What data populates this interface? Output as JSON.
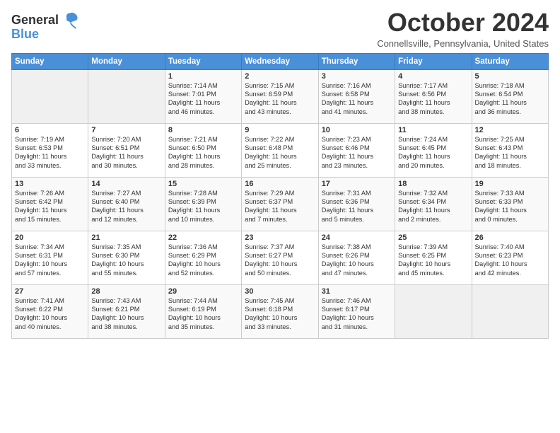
{
  "logo": {
    "line1": "General",
    "line2": "Blue"
  },
  "header": {
    "month": "October 2024",
    "location": "Connellsville, Pennsylvania, United States"
  },
  "weekdays": [
    "Sunday",
    "Monday",
    "Tuesday",
    "Wednesday",
    "Thursday",
    "Friday",
    "Saturday"
  ],
  "weeks": [
    [
      {
        "day": "",
        "content": ""
      },
      {
        "day": "",
        "content": ""
      },
      {
        "day": "1",
        "content": "Sunrise: 7:14 AM\nSunset: 7:01 PM\nDaylight: 11 hours\nand 46 minutes."
      },
      {
        "day": "2",
        "content": "Sunrise: 7:15 AM\nSunset: 6:59 PM\nDaylight: 11 hours\nand 43 minutes."
      },
      {
        "day": "3",
        "content": "Sunrise: 7:16 AM\nSunset: 6:58 PM\nDaylight: 11 hours\nand 41 minutes."
      },
      {
        "day": "4",
        "content": "Sunrise: 7:17 AM\nSunset: 6:56 PM\nDaylight: 11 hours\nand 38 minutes."
      },
      {
        "day": "5",
        "content": "Sunrise: 7:18 AM\nSunset: 6:54 PM\nDaylight: 11 hours\nand 36 minutes."
      }
    ],
    [
      {
        "day": "6",
        "content": "Sunrise: 7:19 AM\nSunset: 6:53 PM\nDaylight: 11 hours\nand 33 minutes."
      },
      {
        "day": "7",
        "content": "Sunrise: 7:20 AM\nSunset: 6:51 PM\nDaylight: 11 hours\nand 30 minutes."
      },
      {
        "day": "8",
        "content": "Sunrise: 7:21 AM\nSunset: 6:50 PM\nDaylight: 11 hours\nand 28 minutes."
      },
      {
        "day": "9",
        "content": "Sunrise: 7:22 AM\nSunset: 6:48 PM\nDaylight: 11 hours\nand 25 minutes."
      },
      {
        "day": "10",
        "content": "Sunrise: 7:23 AM\nSunset: 6:46 PM\nDaylight: 11 hours\nand 23 minutes."
      },
      {
        "day": "11",
        "content": "Sunrise: 7:24 AM\nSunset: 6:45 PM\nDaylight: 11 hours\nand 20 minutes."
      },
      {
        "day": "12",
        "content": "Sunrise: 7:25 AM\nSunset: 6:43 PM\nDaylight: 11 hours\nand 18 minutes."
      }
    ],
    [
      {
        "day": "13",
        "content": "Sunrise: 7:26 AM\nSunset: 6:42 PM\nDaylight: 11 hours\nand 15 minutes."
      },
      {
        "day": "14",
        "content": "Sunrise: 7:27 AM\nSunset: 6:40 PM\nDaylight: 11 hours\nand 12 minutes."
      },
      {
        "day": "15",
        "content": "Sunrise: 7:28 AM\nSunset: 6:39 PM\nDaylight: 11 hours\nand 10 minutes."
      },
      {
        "day": "16",
        "content": "Sunrise: 7:29 AM\nSunset: 6:37 PM\nDaylight: 11 hours\nand 7 minutes."
      },
      {
        "day": "17",
        "content": "Sunrise: 7:31 AM\nSunset: 6:36 PM\nDaylight: 11 hours\nand 5 minutes."
      },
      {
        "day": "18",
        "content": "Sunrise: 7:32 AM\nSunset: 6:34 PM\nDaylight: 11 hours\nand 2 minutes."
      },
      {
        "day": "19",
        "content": "Sunrise: 7:33 AM\nSunset: 6:33 PM\nDaylight: 11 hours\nand 0 minutes."
      }
    ],
    [
      {
        "day": "20",
        "content": "Sunrise: 7:34 AM\nSunset: 6:31 PM\nDaylight: 10 hours\nand 57 minutes."
      },
      {
        "day": "21",
        "content": "Sunrise: 7:35 AM\nSunset: 6:30 PM\nDaylight: 10 hours\nand 55 minutes."
      },
      {
        "day": "22",
        "content": "Sunrise: 7:36 AM\nSunset: 6:29 PM\nDaylight: 10 hours\nand 52 minutes."
      },
      {
        "day": "23",
        "content": "Sunrise: 7:37 AM\nSunset: 6:27 PM\nDaylight: 10 hours\nand 50 minutes."
      },
      {
        "day": "24",
        "content": "Sunrise: 7:38 AM\nSunset: 6:26 PM\nDaylight: 10 hours\nand 47 minutes."
      },
      {
        "day": "25",
        "content": "Sunrise: 7:39 AM\nSunset: 6:25 PM\nDaylight: 10 hours\nand 45 minutes."
      },
      {
        "day": "26",
        "content": "Sunrise: 7:40 AM\nSunset: 6:23 PM\nDaylight: 10 hours\nand 42 minutes."
      }
    ],
    [
      {
        "day": "27",
        "content": "Sunrise: 7:41 AM\nSunset: 6:22 PM\nDaylight: 10 hours\nand 40 minutes."
      },
      {
        "day": "28",
        "content": "Sunrise: 7:43 AM\nSunset: 6:21 PM\nDaylight: 10 hours\nand 38 minutes."
      },
      {
        "day": "29",
        "content": "Sunrise: 7:44 AM\nSunset: 6:19 PM\nDaylight: 10 hours\nand 35 minutes."
      },
      {
        "day": "30",
        "content": "Sunrise: 7:45 AM\nSunset: 6:18 PM\nDaylight: 10 hours\nand 33 minutes."
      },
      {
        "day": "31",
        "content": "Sunrise: 7:46 AM\nSunset: 6:17 PM\nDaylight: 10 hours\nand 31 minutes."
      },
      {
        "day": "",
        "content": ""
      },
      {
        "day": "",
        "content": ""
      }
    ]
  ]
}
